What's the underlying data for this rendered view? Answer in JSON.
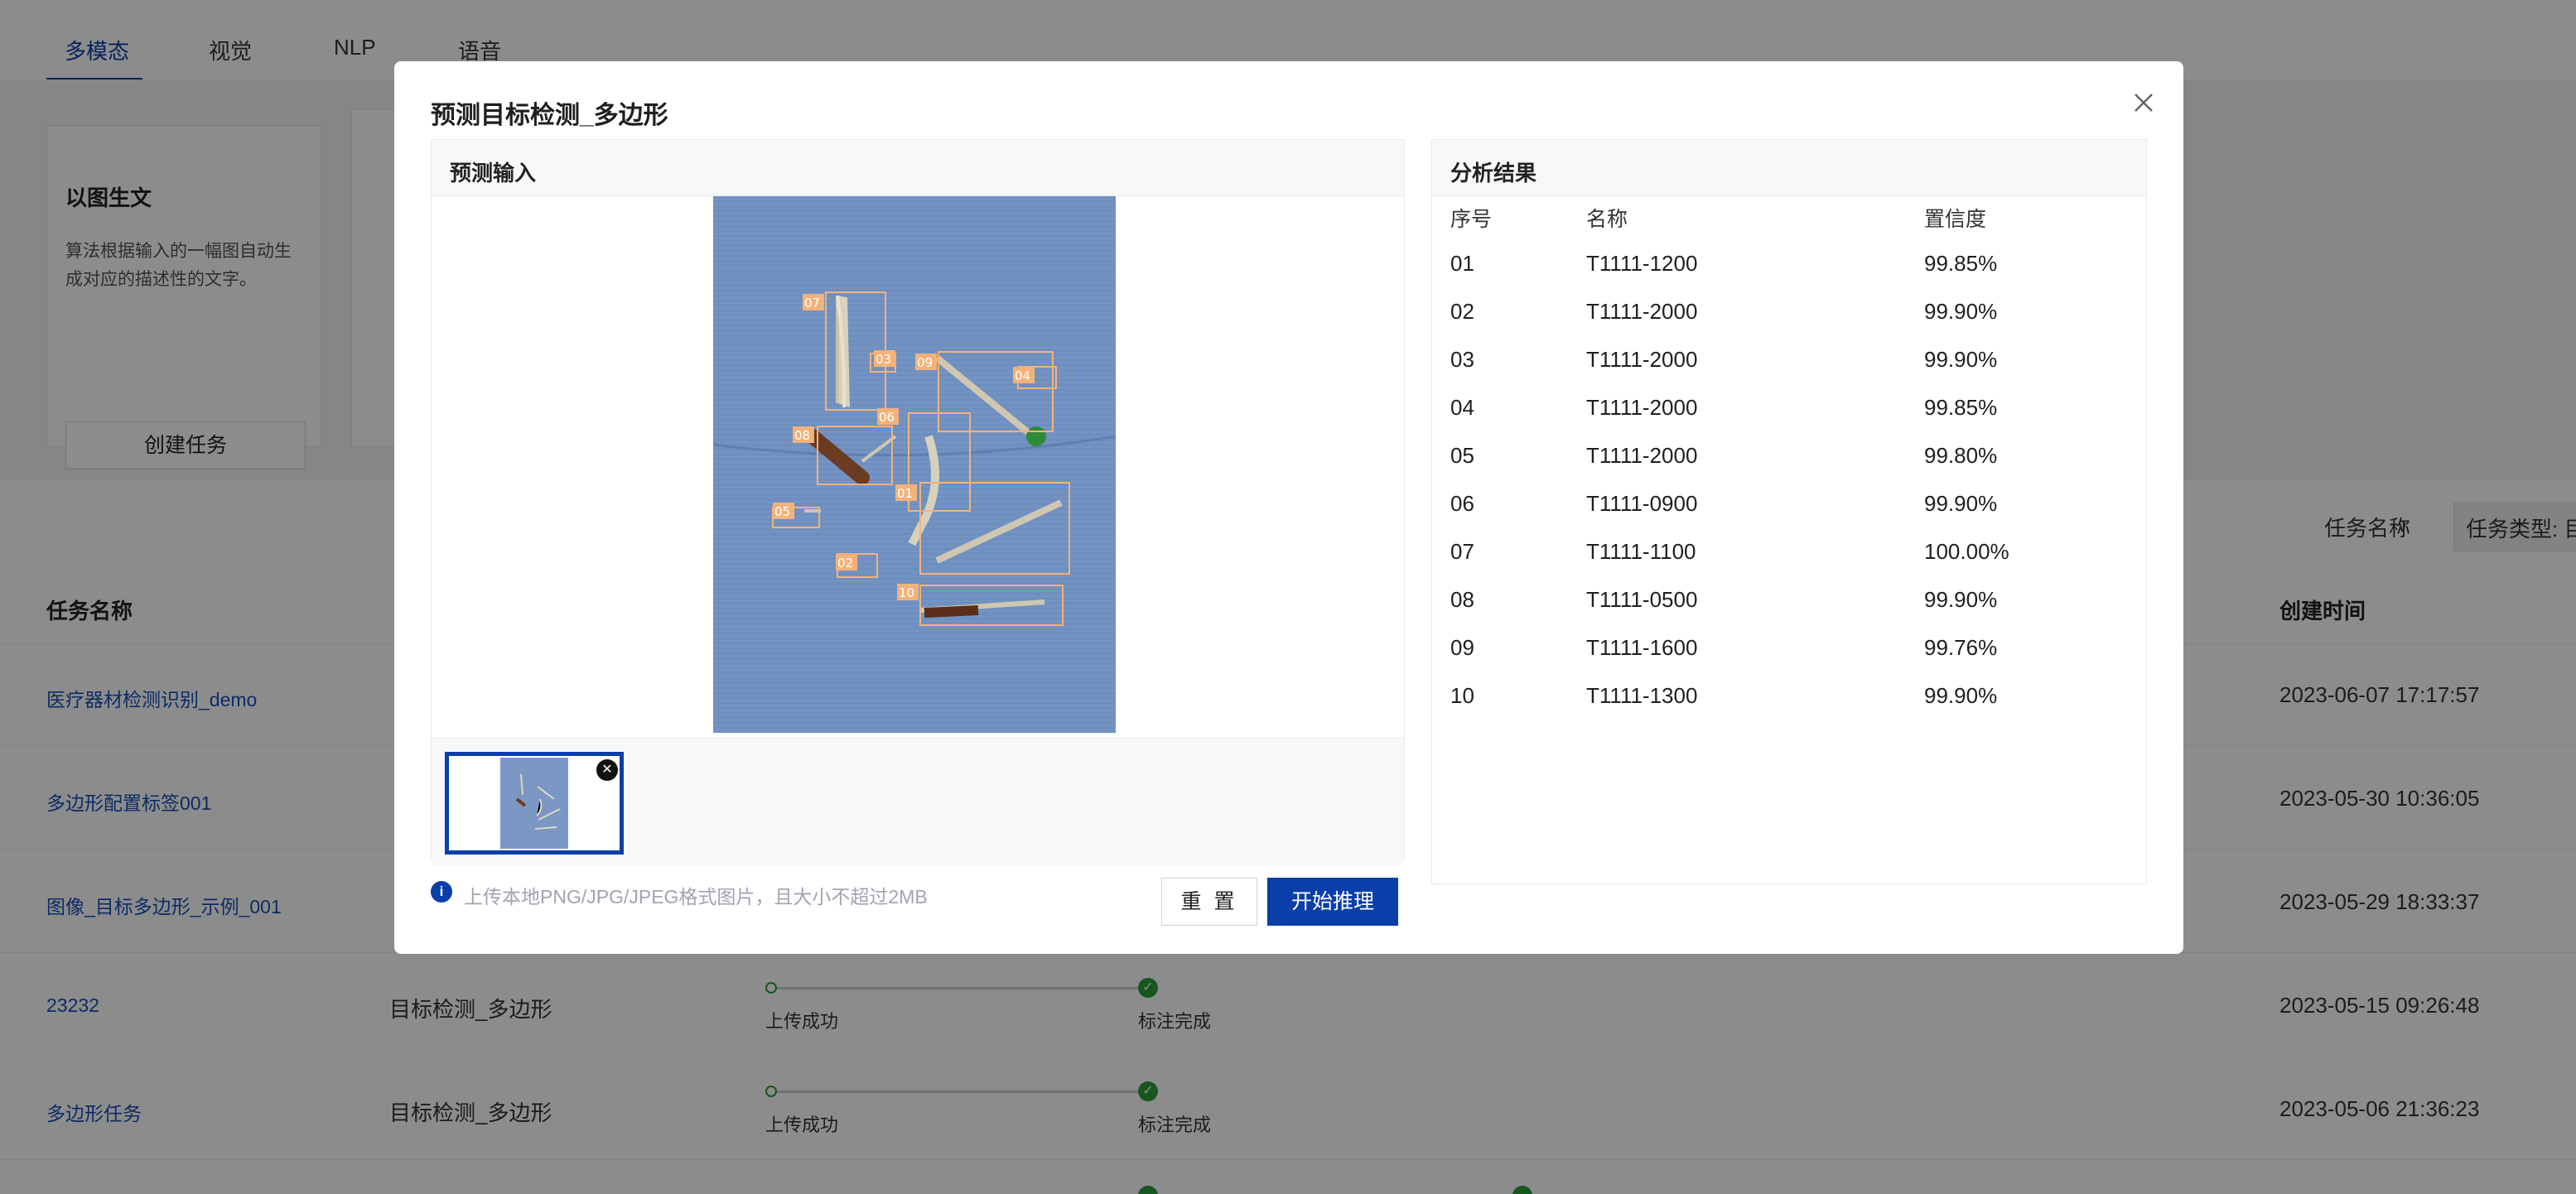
{
  "nav": {
    "tabs": [
      "多模态",
      "视觉",
      "NLP",
      "语音"
    ]
  },
  "card": {
    "title": "以图生文",
    "description": "算法根据输入的一幅图自动生成对应的描述性的文字。",
    "button": "创建任务"
  },
  "filters": {
    "task_name": "任务名称",
    "task_type": "任务类型: 目"
  },
  "table": {
    "headers": {
      "name": "任务名称",
      "created": "创建时间"
    },
    "rows": [
      {
        "name": "医疗器材检测识别_demo",
        "type": "",
        "created": "2023-06-07 17:17:57"
      },
      {
        "name": "多边形配置标签001",
        "type": "",
        "created": "2023-05-30 10:36:05"
      },
      {
        "name": "图像_目标多边形_示例_001",
        "type": "",
        "created": "2023-05-29 18:33:37"
      },
      {
        "name": "23232",
        "type": "目标检测_多边形",
        "step1": "上传成功",
        "step2": "标注完成",
        "created": "2023-05-15 09:26:48"
      },
      {
        "name": "多边形任务",
        "type": "目标检测_多边形",
        "step1": "上传成功",
        "step2": "标注完成",
        "created": "2023-05-06 21:36:23"
      }
    ]
  },
  "modal": {
    "title": "预测目标检测_多边形",
    "input_panel_title": "预测输入",
    "result_panel_title": "分析结果",
    "hint": "上传本地PNG/JPG/JPEG格式图片，且大小不超过2MB",
    "reset_label": "重 置",
    "start_label": "开始推理",
    "result_headers": {
      "index": "序号",
      "name": "名称",
      "confidence": "置信度"
    },
    "results": [
      {
        "index": "01",
        "name": "T1111-1200",
        "confidence": "99.85%"
      },
      {
        "index": "02",
        "name": "T1111-2000",
        "confidence": "99.90%"
      },
      {
        "index": "03",
        "name": "T1111-2000",
        "confidence": "99.90%"
      },
      {
        "index": "04",
        "name": "T1111-2000",
        "confidence": "99.85%"
      },
      {
        "index": "05",
        "name": "T1111-2000",
        "confidence": "99.80%"
      },
      {
        "index": "06",
        "name": "T1111-0900",
        "confidence": "99.90%"
      },
      {
        "index": "07",
        "name": "T1111-1100",
        "confidence": "100.00%"
      },
      {
        "index": "08",
        "name": "T1111-0500",
        "confidence": "99.90%"
      },
      {
        "index": "09",
        "name": "T1111-1600",
        "confidence": "99.76%"
      },
      {
        "index": "10",
        "name": "T1111-1300",
        "confidence": "99.90%"
      }
    ],
    "detections": [
      "07",
      "03",
      "09",
      "04",
      "06",
      "08",
      "01",
      "05",
      "02",
      "10"
    ]
  },
  "colors": {
    "primary": "#0a3ea8",
    "success": "#2a9d3c",
    "box": "#f3b27a",
    "cloth": "#6f8fbf"
  },
  "icons": {
    "close": "close-icon",
    "info": "info-icon",
    "check": "check-icon",
    "chevron": "chevron-down-icon"
  }
}
